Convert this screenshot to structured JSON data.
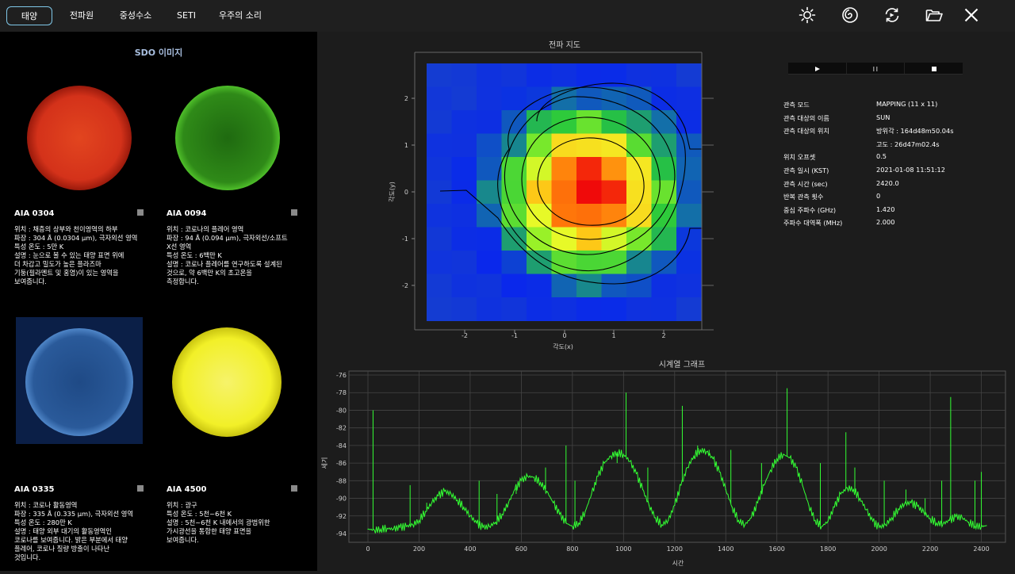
{
  "tabs": [
    {
      "label": "태양",
      "active": true
    },
    {
      "label": "전파원",
      "active": false
    },
    {
      "label": "중성수소",
      "active": false
    },
    {
      "label": "SETI",
      "active": false
    },
    {
      "label": "우주의 소리",
      "active": false
    }
  ],
  "toolbar": {
    "icons": [
      "sun-icon",
      "galaxy-icon",
      "refresh-icon",
      "folder-open-icon",
      "close-icon"
    ]
  },
  "left": {
    "title": "SDO 이미지",
    "cards": [
      {
        "name": "AIA 0304",
        "image_color": "#d8341c",
        "desc": "위치 : 채층의 상부와 천이영역의 하부\n파장 : 304 Å (0.0304 µm), 극자외선 영역\n특성 온도 : 5만 K\n설명 : 눈으로 볼 수 있는 태양 표면 위에\n더 차갑고 밀도가 높은 플라즈마\n기둥(필라멘트 및 홍염)이 있는 영역을\n보여줍니다."
      },
      {
        "name": "AIA 0094",
        "image_color": "#2f8a18",
        "desc": "위치 : 코로나의 플레어 영역\n파장 : 94 Å (0.094 µm), 극자외선/소프트\nX선 영역\n특성 온도 : 6백만 K\n설명 : 코로나 플레어를 연구하도록 설계된\n것으로, 약 6백만 K의 초고온을\n측정합니다."
      },
      {
        "name": "AIA 0335",
        "image_color": "#2a5a9a",
        "desc": "위치 : 코로나 활동영역\n파장 : 335 Å (0.335 µm), 극자외선 영역\n특성 온도 : 280만 K\n설명 : 태양 외부 대기의 활동영역인\n코로나를 보여줍니다. 밝은 부분에서 태양\n플레어, 코로나 질량 방출이 나타난\n것입니다."
      },
      {
        "name": "AIA 4500",
        "image_color": "#f2f028",
        "desc": "위치 : 광구\n특성 온도 : 5천~6천 K\n설명 : 5천~6천 K 내에서의 광범위한\n가시광선을 통합한 태양 표면을\n보여줍니다."
      }
    ]
  },
  "map": {
    "title": "전파 지도",
    "xlabel": "각도(x)",
    "ylabel": "각도(y)",
    "xticks": [
      "-2",
      "-1",
      "0",
      "1",
      "2"
    ],
    "yticks": [
      "2",
      "1",
      "0",
      "-1",
      "-2"
    ]
  },
  "player": {
    "play": "▶",
    "pause": "⏸",
    "stop": "■"
  },
  "info": [
    {
      "label": "관측 모드",
      "value": "MAPPING (11 x 11)"
    },
    {
      "label": "관측 대상의 이름",
      "value": "SUN"
    },
    {
      "label": "관측 대상의 위치",
      "value": "방위각 : 164d48m50.04s"
    },
    {
      "label": "",
      "value": "고도   :  26d47m02.4s"
    },
    {
      "label": "위치 오프셋",
      "value": "0.5"
    },
    {
      "label": "관측 일시 (KST)",
      "value": "2021-01-08 11:51:12"
    },
    {
      "label": "관측 시간 (sec)",
      "value": "2420.0"
    },
    {
      "label": "반복 관측 횟수",
      "value": "0"
    },
    {
      "label": "중심 주파수 (GHz)",
      "value": "1.420"
    },
    {
      "label": "주파수 대역폭 (MHz)",
      "value": "2.000"
    }
  ],
  "chart_data": {
    "type": "line",
    "title": "시계열 그래프",
    "xlabel": "시간",
    "ylabel": "세기",
    "xlim": [
      0,
      2420
    ],
    "ylim": [
      -94,
      -76
    ],
    "xticks": [
      "0",
      "200",
      "400",
      "600",
      "800",
      "1000",
      "1200",
      "1400",
      "1600",
      "1800",
      "2000",
      "2200",
      "2400"
    ],
    "yticks": [
      "-76",
      "-78",
      "-80",
      "-82",
      "-84",
      "-86",
      "-88",
      "-90",
      "-92",
      "-94"
    ],
    "grid": true,
    "series": [
      {
        "color": "#33ff33",
        "x": [
          0,
          25,
          50,
          75,
          100,
          125,
          150,
          175,
          200,
          225,
          250,
          275,
          300,
          325,
          350,
          375,
          400,
          425,
          450,
          475,
          500,
          525,
          550,
          575,
          600,
          625,
          650,
          675,
          700,
          725,
          750,
          775,
          800,
          825,
          850,
          875,
          900,
          925,
          950,
          975,
          1000,
          1025,
          1050,
          1075,
          1100,
          1125,
          1150,
          1175,
          1200,
          1225,
          1250,
          1275,
          1300,
          1325,
          1350,
          1375,
          1400,
          1425,
          1450,
          1475,
          1500,
          1525,
          1550,
          1575,
          1600,
          1625,
          1650,
          1675,
          1700,
          1725,
          1750,
          1775,
          1800,
          1825,
          1850,
          1875,
          1900,
          1925,
          1950,
          1975,
          2000,
          2025,
          2050,
          2075,
          2100,
          2125,
          2150,
          2175,
          2200,
          2225,
          2250,
          2275,
          2300,
          2325,
          2350,
          2375,
          2400,
          2420
        ],
        "y": [
          -93.5,
          -93.6,
          -93.5,
          -93.4,
          -93.5,
          -93.3,
          -93.2,
          -93.0,
          -92.5,
          -91.5,
          -90.5,
          -89.7,
          -89.2,
          -89.5,
          -90.2,
          -91.0,
          -92.0,
          -92.8,
          -93.3,
          -93.2,
          -92.7,
          -91.8,
          -90.5,
          -89.0,
          -88.0,
          -87.5,
          -87.6,
          -88.2,
          -89.2,
          -90.5,
          -91.8,
          -92.8,
          -93.2,
          -92.8,
          -91.5,
          -89.5,
          -87.5,
          -86.0,
          -85.2,
          -84.8,
          -85.0,
          -85.8,
          -87.2,
          -89.0,
          -90.8,
          -92.2,
          -93.0,
          -92.5,
          -90.8,
          -88.5,
          -86.5,
          -85.2,
          -84.5,
          -84.7,
          -85.5,
          -87.0,
          -89.0,
          -91.0,
          -92.5,
          -93.0,
          -92.2,
          -90.5,
          -88.5,
          -86.8,
          -85.5,
          -85.0,
          -85.4,
          -86.5,
          -88.5,
          -90.8,
          -92.5,
          -93.2,
          -92.6,
          -91.0,
          -89.5,
          -88.8,
          -89.0,
          -90.0,
          -91.3,
          -92.6,
          -93.3,
          -93.0,
          -92.2,
          -91.2,
          -90.6,
          -90.5,
          -90.9,
          -91.6,
          -92.3,
          -92.8,
          -92.9,
          -92.5,
          -92.1,
          -92.2,
          -92.7,
          -93.1,
          -93.2,
          -93.1
        ]
      }
    ],
    "spikes": [
      {
        "x": 20,
        "y": -80.0
      },
      {
        "x": 165,
        "y": -88.5
      },
      {
        "x": 230,
        "y": -90.5
      },
      {
        "x": 435,
        "y": -88.0
      },
      {
        "x": 505,
        "y": -89.5
      },
      {
        "x": 580,
        "y": -89.5
      },
      {
        "x": 695,
        "y": -86.5
      },
      {
        "x": 775,
        "y": -84.0
      },
      {
        "x": 810,
        "y": -88.0
      },
      {
        "x": 975,
        "y": -86.0
      },
      {
        "x": 1010,
        "y": -78.0
      },
      {
        "x": 1095,
        "y": -86.5
      },
      {
        "x": 1230,
        "y": -79.5
      },
      {
        "x": 1290,
        "y": -84.0
      },
      {
        "x": 1335,
        "y": -84.5
      },
      {
        "x": 1420,
        "y": -84.5
      },
      {
        "x": 1540,
        "y": -86.0
      },
      {
        "x": 1640,
        "y": -77.5
      },
      {
        "x": 1770,
        "y": -86.0
      },
      {
        "x": 1870,
        "y": -82.5
      },
      {
        "x": 1905,
        "y": -86.5
      },
      {
        "x": 2020,
        "y": -88.0
      },
      {
        "x": 2105,
        "y": -89.0
      },
      {
        "x": 2180,
        "y": -90.0
      },
      {
        "x": 2245,
        "y": -88.0
      },
      {
        "x": 2280,
        "y": -78.5
      },
      {
        "x": 2375,
        "y": -88.0
      },
      {
        "x": 2400,
        "y": -87.0
      }
    ]
  }
}
